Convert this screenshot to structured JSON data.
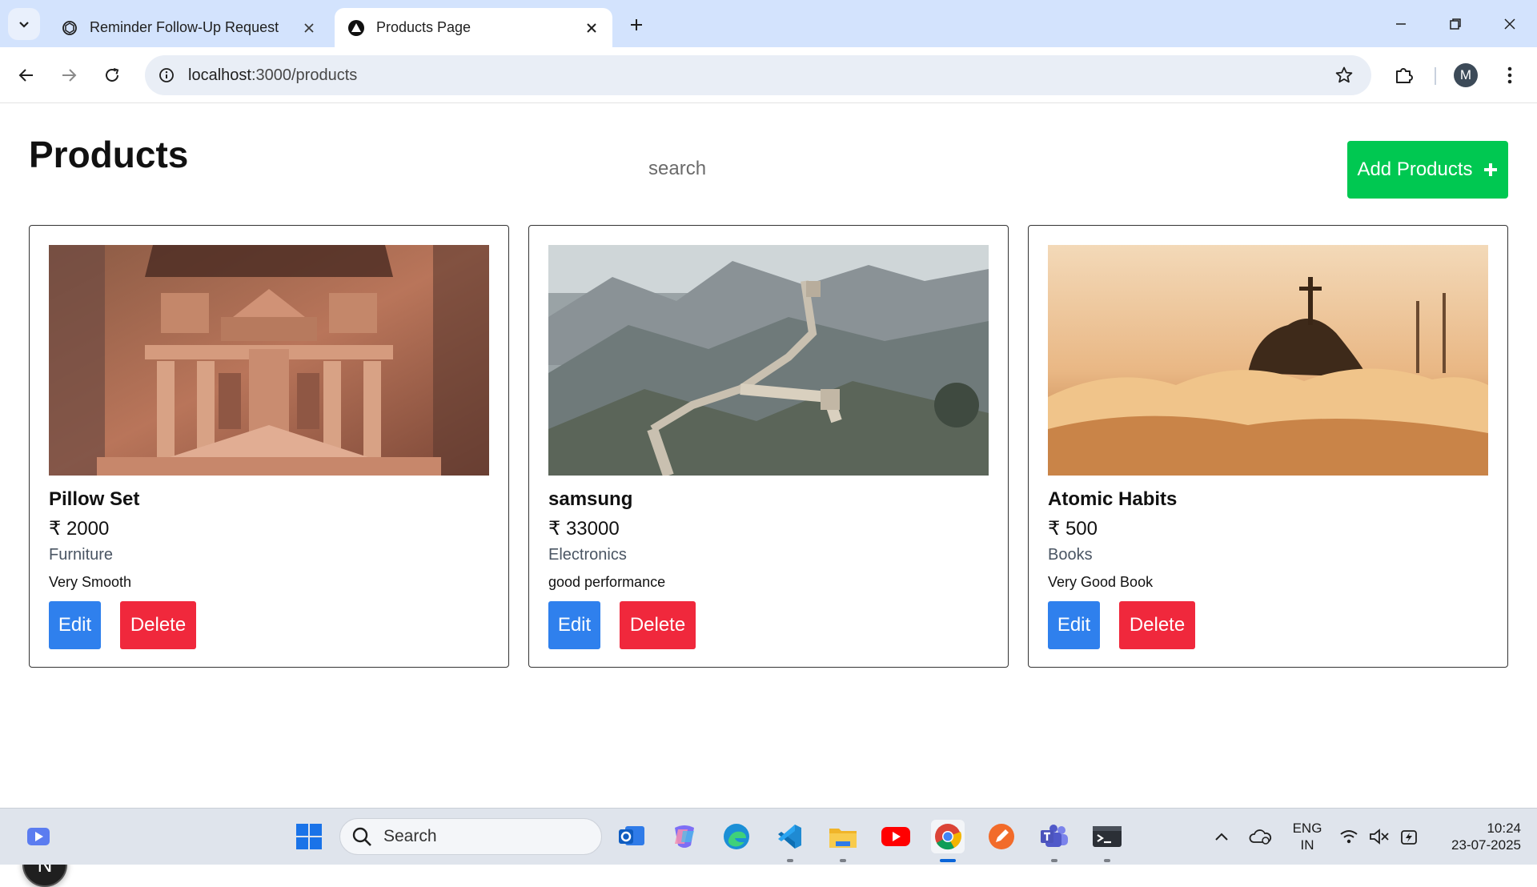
{
  "browser": {
    "tabs": [
      {
        "title": "Reminder Follow-Up Request",
        "icon": "chatgpt-icon",
        "active": false
      },
      {
        "title": "Products Page",
        "icon": "nextjs-icon",
        "active": true
      }
    ],
    "url_host": "localhost",
    "url_path": ":3000/products",
    "profile_initial": "M"
  },
  "page": {
    "title": "Products",
    "search_placeholder": "search",
    "add_button_label": "Add Products",
    "products": [
      {
        "name": "Pillow Set",
        "price": "₹ 2000",
        "category": "Furniture",
        "description": "Very Smooth",
        "image": "petra-treasury"
      },
      {
        "name": "samsung",
        "price": "₹ 33000",
        "category": "Electronics",
        "description": "good performance",
        "image": "great-wall"
      },
      {
        "name": "Atomic Habits",
        "price": "₹ 500",
        "category": "Books",
        "description": "Very Good Book",
        "image": "christ-redeemer"
      }
    ],
    "edit_label": "Edit",
    "delete_label": "Delete",
    "dev_badge": "N"
  },
  "taskbar": {
    "search_label": "Search",
    "language_line1": "ENG",
    "language_line2": "IN",
    "time": "10:24",
    "date": "23-07-2025"
  },
  "colors": {
    "add_button": "#00c851",
    "edit_button": "#2f80ed",
    "delete_button": "#f0283c",
    "tabstrip": "#d3e3fd"
  }
}
